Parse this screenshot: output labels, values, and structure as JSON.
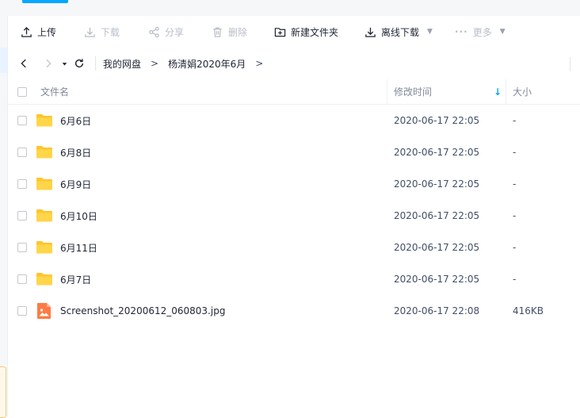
{
  "toolbar": {
    "upload": "上传",
    "download": "下载",
    "share": "分享",
    "delete": "删除",
    "new_folder": "新建文件夹",
    "offline_download": "离线下载",
    "more": "更多"
  },
  "nav": {
    "breadcrumbs": [
      "我的网盘",
      "杨清娟2020年6月"
    ],
    "separator": ">"
  },
  "table": {
    "columns": {
      "name": "文件名",
      "modified": "修改时间",
      "size": "大小"
    },
    "sort_indicator": "↓",
    "rows": [
      {
        "name": "6月6日",
        "modified": "2020-06-17 22:05",
        "size": "-",
        "type": "folder-icon"
      },
      {
        "name": "6月8日",
        "modified": "2020-06-17 22:05",
        "size": "-",
        "type": "folder-icon"
      },
      {
        "name": "6月9日",
        "modified": "2020-06-17 22:05",
        "size": "-",
        "type": "folder-icon"
      },
      {
        "name": "6月10日",
        "modified": "2020-06-17 22:05",
        "size": "-",
        "type": "folder-icon"
      },
      {
        "name": "6月11日",
        "modified": "2020-06-17 22:05",
        "size": "-",
        "type": "folder-icon"
      },
      {
        "name": "6月7日",
        "modified": "2020-06-17 22:05",
        "size": "-",
        "type": "folder-icon"
      },
      {
        "name": "Screenshot_20200612_060803.jpg",
        "modified": "2020-06-17 22:08",
        "size": "416KB",
        "type": "image-file-icon"
      }
    ]
  },
  "colors": {
    "accent": "#06a7ff",
    "folder": "#ffc629",
    "image_file": "#ff7a45"
  }
}
